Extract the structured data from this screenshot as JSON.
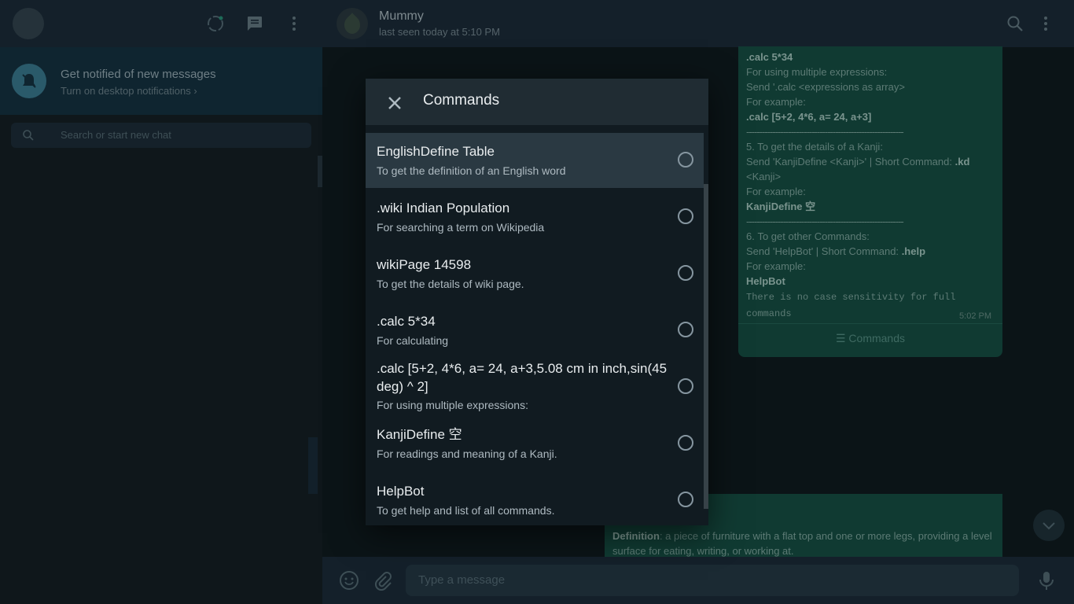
{
  "sidebar": {
    "notification": {
      "title": "Get notified of new messages",
      "subtitle": "Turn on desktop notifications ›"
    },
    "search": {
      "placeholder": "Search or start new chat"
    }
  },
  "chat": {
    "contact": {
      "name": "Mummy",
      "status": "last seen today at 5:10 PM"
    },
    "bubble_top": {
      "lines": [
        {
          "text": ".calc 5*34",
          "bold": true
        },
        {
          "text": "For using multiple expressions:"
        },
        {
          "text": "Send '.calc <expressions as array>"
        },
        {
          "text": "For example:"
        },
        {
          "text": ".calc [5+2, 4*6, a= 24, a+3]",
          "bold": true
        },
        {
          "text": "------------------------------------------------------------"
        },
        {
          "text": "5. To get the details of a Kanji:"
        },
        {
          "text": "Send 'KanjiDefine <Kanji>' | Short Command:"
        },
        {
          "text": ".kd",
          "bold": true
        },
        {
          "text": "<Kanji>"
        },
        {
          "text": "For example:"
        },
        {
          "text": "KanjiDefine 空",
          "bold": true
        },
        {
          "text": "------------------------------------------------------------"
        },
        {
          "text": "6. To get other Commands:"
        },
        {
          "text": "Send 'HelpBot' | Short Command:"
        },
        {
          "text": ".help",
          "bold": true
        },
        {
          "text": "For example:"
        },
        {
          "text": "HelpBot",
          "bold": true
        },
        {
          "text": "There is no case sensitivity for full commands"
        }
      ],
      "time": "5:02 PM",
      "commands_button": "☰ Commands"
    },
    "bubble_bottom": {
      "label": "Definition",
      "text": ": a piece of furniture with a flat top and one or more legs, providing a level surface for eating, writing, or working at."
    },
    "composer": {
      "placeholder": "Type a message"
    }
  },
  "modal": {
    "title": "Commands",
    "items": [
      {
        "title": "EnglishDefine Table",
        "desc": "To get the definition of an English word",
        "active": true
      },
      {
        "title": ".wiki Indian Population",
        "desc": "For searching a term on Wikipedia"
      },
      {
        "title": "wikiPage 14598",
        "desc": "To get the details of wiki page."
      },
      {
        "title": ".calc 5*34",
        "desc": "For calculating"
      },
      {
        "title": ".calc [5+2, 4*6, a= 24, a+3,5.08 cm in inch,sin(45 deg) ^ 2]",
        "desc": "For using multiple expressions:"
      },
      {
        "title": "KanjiDefine 空",
        "desc": "For readings and meaning of a Kanji."
      },
      {
        "title": "HelpBot",
        "desc": "To get help and list of all commands."
      }
    ]
  }
}
